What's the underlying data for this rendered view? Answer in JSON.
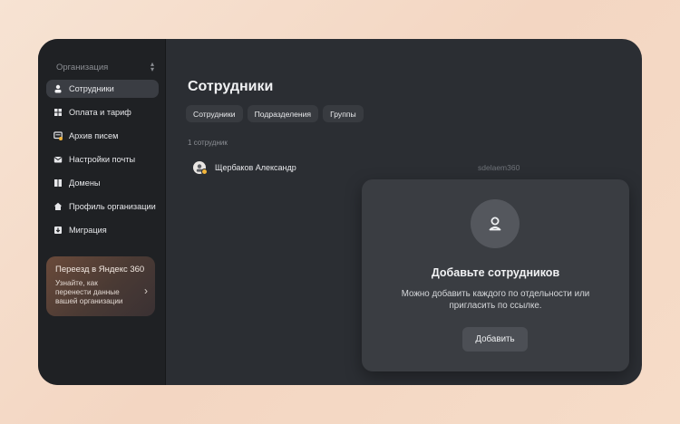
{
  "sidebar": {
    "org_label": "Организация",
    "items": [
      {
        "label": "Сотрудники",
        "icon": "person-icon",
        "active": true
      },
      {
        "label": "Оплата и тариф",
        "icon": "grid-icon"
      },
      {
        "label": "Архив писем",
        "icon": "archive-icon"
      },
      {
        "label": "Настройки почты",
        "icon": "mail-icon"
      },
      {
        "label": "Домены",
        "icon": "domains-icon"
      },
      {
        "label": "Профиль организации",
        "icon": "home-icon"
      },
      {
        "label": "Миграция",
        "icon": "migration-icon"
      }
    ],
    "promo": {
      "title": "Переезд в Яндекс 360",
      "text": "Узнайте, как перенести данные вашей организации"
    }
  },
  "main": {
    "title": "Сотрудники",
    "tabs": [
      "Сотрудники",
      "Подразделения",
      "Группы"
    ],
    "count": "1 сотрудник",
    "employees": [
      {
        "name": "Щербаков Александр",
        "login": "sdelaem360"
      }
    ]
  },
  "modal": {
    "title": "Добавьте сотрудников",
    "text": "Можно добавить каждого по отдельности или пригласить по ссылке.",
    "button": "Добавить"
  },
  "colors": {
    "background": "#f5ddc9",
    "sidebar": "#1f2124",
    "main": "#2b2e33",
    "accent_dot": "#f2b53b"
  }
}
